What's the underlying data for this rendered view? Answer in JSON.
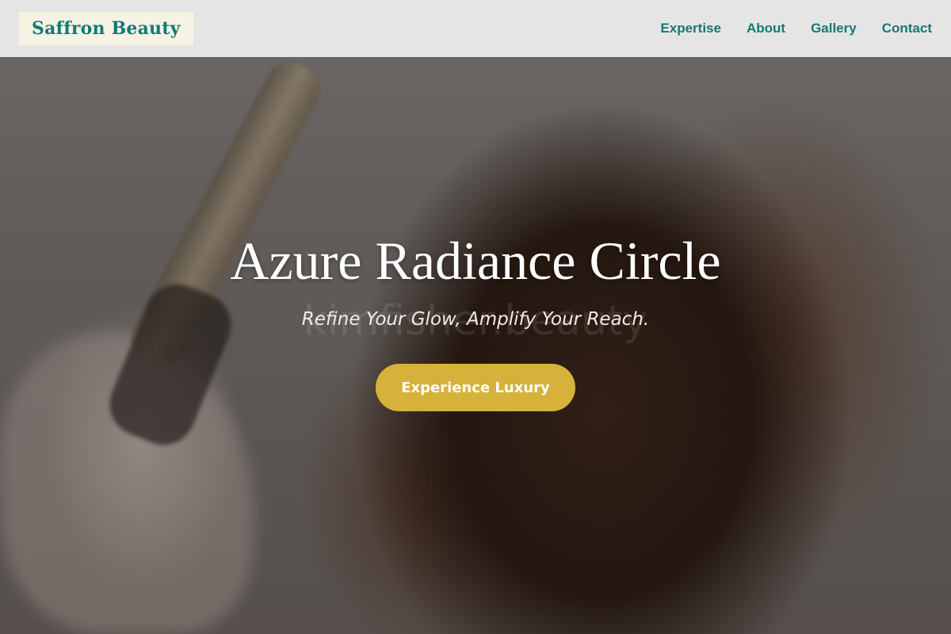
{
  "header": {
    "logo_text": "Saffron Beauty",
    "nav": [
      {
        "label": "Expertise"
      },
      {
        "label": "About"
      },
      {
        "label": "Gallery"
      },
      {
        "label": "Contact"
      }
    ]
  },
  "hero": {
    "title": "Azure Radiance Circle",
    "subtitle": "Refine Your Glow, Amplify Your Reach.",
    "watermark": "kimfisher.beauty",
    "cta_label": "Experience Luxury"
  },
  "colors": {
    "brand_teal": "#137a76",
    "cta_gold": "#d6b23a",
    "logo_bg": "#f6f3e4"
  }
}
